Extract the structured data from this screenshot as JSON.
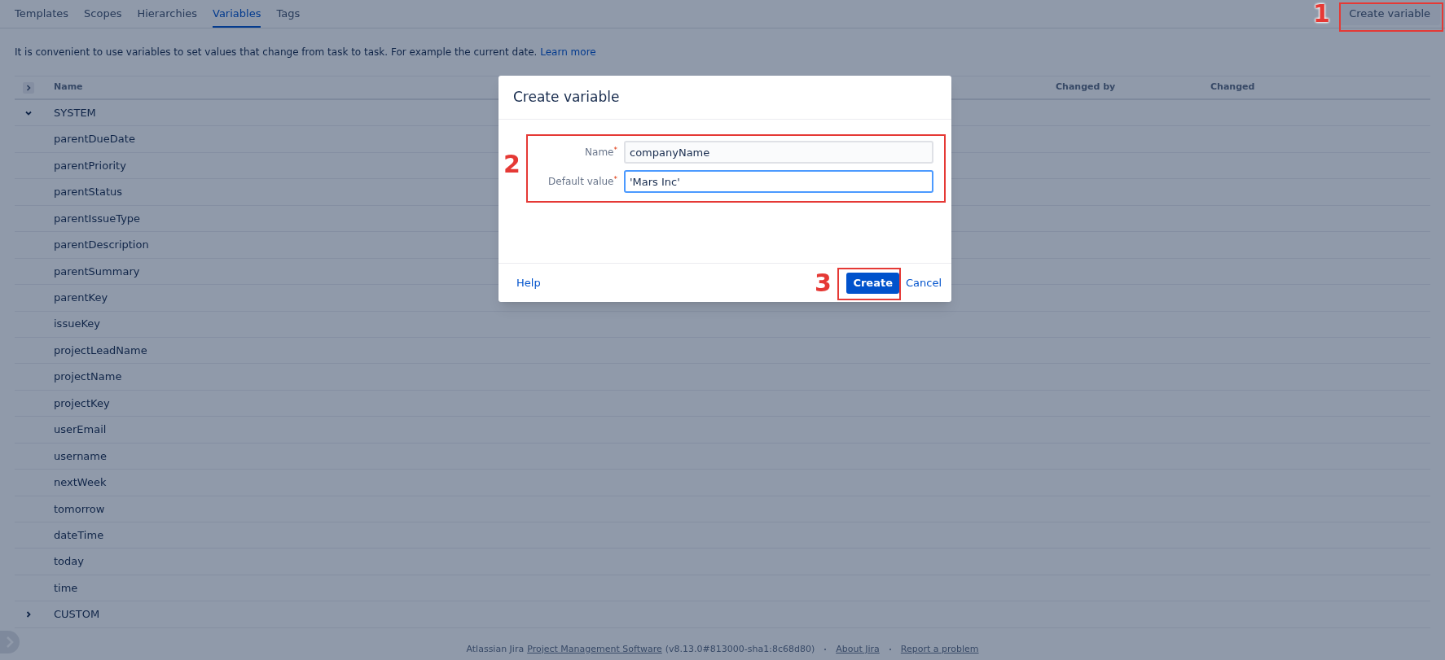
{
  "tabs": [
    {
      "label": "Templates",
      "selected": false
    },
    {
      "label": "Scopes",
      "selected": false
    },
    {
      "label": "Hierarchies",
      "selected": false
    },
    {
      "label": "Variables",
      "selected": true
    },
    {
      "label": "Tags",
      "selected": false
    }
  ],
  "create_variable_button": {
    "label": "Create variable",
    "callout": "1"
  },
  "description": {
    "text": "It is convenient to use variables to set values that change from task to task. For example the current date.",
    "link": "Learn more"
  },
  "table": {
    "columns": [
      "Name",
      "Changed by",
      "Changed"
    ],
    "groups": [
      {
        "name": "SYSTEM",
        "expanded": true,
        "children": [
          {
            "name": "parentDueDate"
          },
          {
            "name": "parentPriority"
          },
          {
            "name": "parentStatus"
          },
          {
            "name": "parentIssueType"
          },
          {
            "name": "parentDescription"
          },
          {
            "name": "parentSummary"
          },
          {
            "name": "parentKey"
          },
          {
            "name": "issueKey"
          },
          {
            "name": "projectLeadName"
          },
          {
            "name": "projectName"
          },
          {
            "name": "projectKey"
          },
          {
            "name": "userEmail"
          },
          {
            "name": "username"
          },
          {
            "name": "nextWeek"
          },
          {
            "name": "tomorrow"
          },
          {
            "name": "dateTime"
          },
          {
            "name": "today"
          },
          {
            "name": "time"
          }
        ]
      },
      {
        "name": "CUSTOM",
        "expanded": false
      }
    ]
  },
  "dialog": {
    "title": "Create variable",
    "form_callout": "2",
    "fields": [
      {
        "label": "Name$^{*}$",
        "value": "companyName",
        "focused": false
      },
      {
        "label": "Default value$^{*}$",
        "value": "'Mars Inc'",
        "focused": true
      }
    ],
    "help": "Help",
    "create_button": "Create",
    "create_callout": "3",
    "cancel": "Cancel"
  },
  "footer": {
    "prefix": "Atlassian Jira",
    "product_link": "Project Management Software",
    "version": "(v8.13.0#813000-sha1:8c68d80)",
    "about_link": "About Jira",
    "report_link": "Report a problem"
  }
}
